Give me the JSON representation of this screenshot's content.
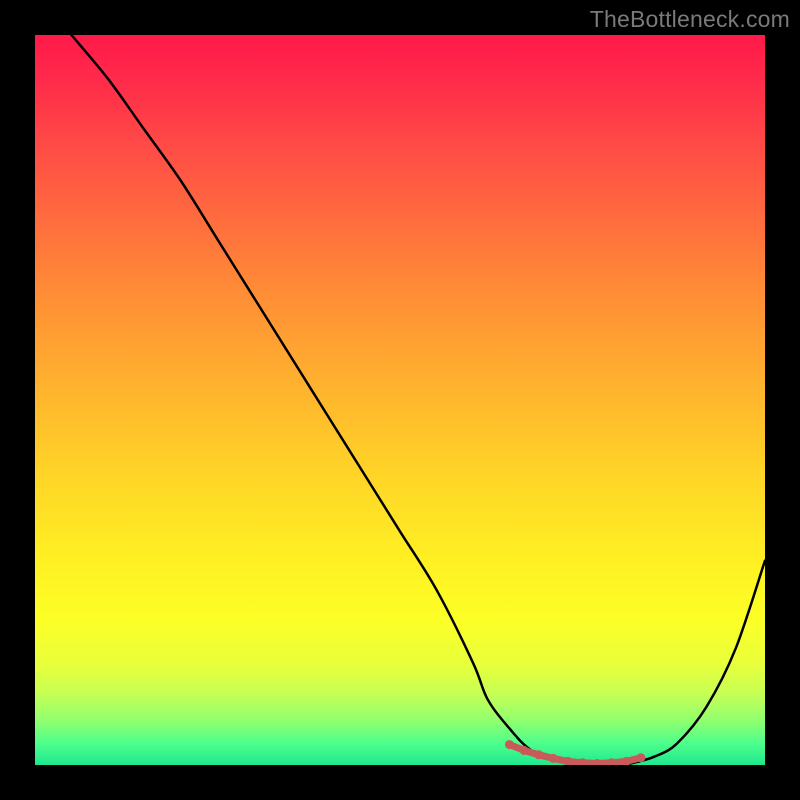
{
  "watermark": "TheBottleneck.com",
  "colors": {
    "background": "#000000",
    "watermark": "#7a7a7a",
    "curve": "#000000",
    "markers": "#c85a5a"
  },
  "chart_data": {
    "type": "line",
    "title": "",
    "xlabel": "",
    "ylabel": "",
    "xlim": [
      0,
      100
    ],
    "ylim": [
      0,
      100
    ],
    "series": [
      {
        "name": "bottleneck-curve",
        "x": [
          5,
          10,
          15,
          20,
          25,
          30,
          35,
          40,
          45,
          50,
          55,
          60,
          62,
          65,
          68,
          72,
          76,
          80,
          82,
          85,
          88,
          92,
          96,
          100
        ],
        "y": [
          100,
          94,
          87,
          80,
          72,
          64,
          56,
          48,
          40,
          32,
          24,
          14,
          9,
          5,
          2,
          0.5,
          0,
          0,
          0.3,
          1.2,
          3,
          8,
          16,
          28
        ]
      }
    ],
    "markers": {
      "name": "optimal-range",
      "x": [
        65,
        67,
        69,
        71,
        73,
        75,
        77,
        79,
        81,
        83
      ],
      "y": [
        2.8,
        2.0,
        1.4,
        0.9,
        0.5,
        0.3,
        0.2,
        0.3,
        0.5,
        1.0
      ]
    },
    "annotations": []
  }
}
